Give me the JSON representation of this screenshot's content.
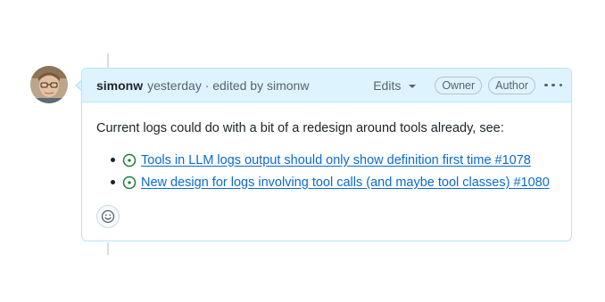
{
  "comment": {
    "author": "simonw",
    "meta": "yesterday · edited by simonw",
    "edits_label": "Edits",
    "badges": [
      "Owner",
      "Author"
    ],
    "intro": "Current logs could do with a bit of a redesign around tools already, see:",
    "links": [
      {
        "text": "Tools in LLM logs output should only show definition first time #1078",
        "icon": "issue-open-icon"
      },
      {
        "text": "New design for logs involving tool calls (and maybe tool classes) #1080",
        "icon": "issue-open-icon"
      }
    ]
  },
  "colors": {
    "header_bg": "#ddf4ff",
    "border": "#b6e3ff",
    "link": "#0969da",
    "issue_open": "#1a7f37"
  }
}
